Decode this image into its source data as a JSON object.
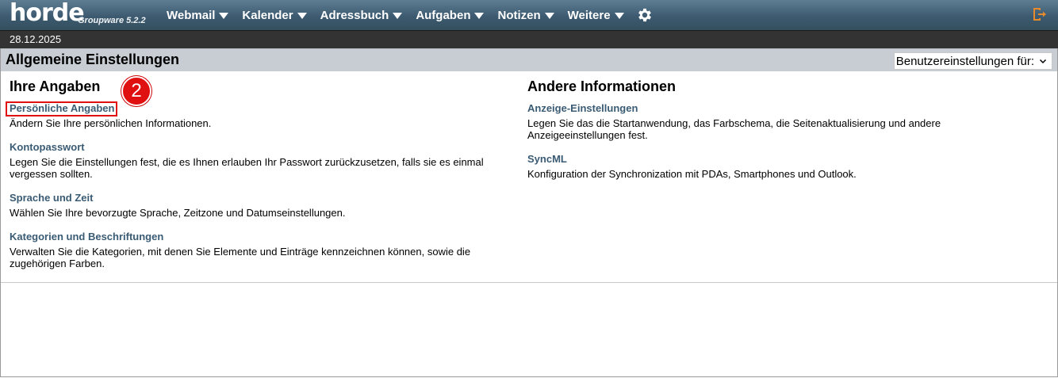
{
  "brand": {
    "logo": "horde",
    "version": "Groupware 5.2.2"
  },
  "nav": {
    "items": [
      {
        "label": "Webmail"
      },
      {
        "label": "Kalender"
      },
      {
        "label": "Adressbuch"
      },
      {
        "label": "Aufgaben"
      },
      {
        "label": "Notizen"
      },
      {
        "label": "Weitere"
      }
    ]
  },
  "date": "28.12.2025",
  "page": {
    "title": "Allgemeine Einstellungen",
    "user_select_label": "Benutzereinstellungen für:"
  },
  "annotation": {
    "badge": "2"
  },
  "left": {
    "heading": "Ihre Angaben",
    "entries": [
      {
        "title": "Persönliche Angaben",
        "desc": "Ändern Sie Ihre persönlichen Informationen."
      },
      {
        "title": "Kontopasswort",
        "desc": "Legen Sie die Einstellungen fest, die es Ihnen erlauben Ihr Passwort zurückzusetzen, falls sie es einmal vergessen sollten."
      },
      {
        "title": "Sprache und Zeit",
        "desc": "Wählen Sie Ihre bevorzugte Sprache, Zeitzone und Datumseinstellungen."
      },
      {
        "title": "Kategorien und Beschriftungen",
        "desc": "Verwalten Sie die Kategorien, mit denen Sie Elemente und Einträge kennzeichnen können, sowie die zugehörigen Farben."
      }
    ]
  },
  "right": {
    "heading": "Andere Informationen",
    "entries": [
      {
        "title": "Anzeige-Einstellungen",
        "desc": "Legen Sie das die Startanwendung, das Farbschema, die Seitenaktualisierung und andere Anzeigeeinstellungen fest."
      },
      {
        "title": "SyncML",
        "desc": "Konfiguration der Synchronization mit PDAs, Smartphones und Outlook."
      }
    ]
  },
  "colors": {
    "topbar": "#3d5a70",
    "datebar": "#333333",
    "header": "#c7cdd3",
    "link": "#3a5b74",
    "highlight": "#e01010",
    "logout_icon": "#e8892b"
  },
  "icons": {
    "settings": "gear-icon",
    "logout": "logout-icon",
    "menu": "caret-down-icon"
  }
}
